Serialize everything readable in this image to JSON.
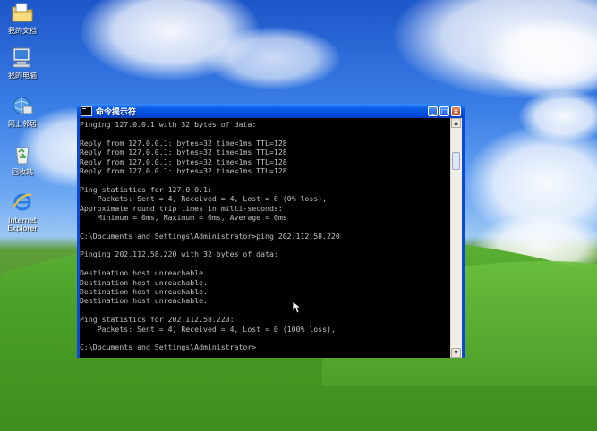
{
  "desktop": {
    "icons": [
      {
        "label": "我的文档",
        "icon": "folder-icon"
      },
      {
        "label": "我的电脑",
        "icon": "computer-icon"
      },
      {
        "label": "网上邻居",
        "icon": "network-icon"
      },
      {
        "label": "回收站",
        "icon": "recycle-bin-icon"
      },
      {
        "label": "Internet Explorer",
        "icon": "ie-icon"
      }
    ]
  },
  "window": {
    "title": "命令提示符",
    "buttons": {
      "minimize": "_",
      "maximize": "□",
      "close": "×"
    }
  },
  "console": {
    "lines": [
      "Pinging 127.0.0.1 with 32 bytes of data:",
      "",
      "Reply from 127.0.0.1: bytes=32 time<1ms TTL=128",
      "Reply from 127.0.0.1: bytes=32 time<1ms TTL=128",
      "Reply from 127.0.0.1: bytes=32 time<1ms TTL=128",
      "Reply from 127.0.0.1: bytes=32 time<1ms TTL=128",
      "",
      "Ping statistics for 127.0.0.1:",
      "    Packets: Sent = 4, Received = 4, Lost = 0 (0% loss),",
      "Approximate round trip times in milli-seconds:",
      "    Minimum = 0ms, Maximum = 0ms, Average = 0ms",
      "",
      "C:\\Documents and Settings\\Administrator>ping 202.112.58.220",
      "",
      "Pinging 202.112.58.220 with 32 bytes of data:",
      "",
      "Destination host unreachable.",
      "Destination host unreachable.",
      "Destination host unreachable.",
      "Destination host unreachable.",
      "",
      "Ping statistics for 202.112.58.220:",
      "    Packets: Sent = 4, Received = 4, Lost = 0 (100% loss),",
      "",
      "C:\\Documents and Settings\\Administrator>"
    ]
  },
  "colors": {
    "console_bg": "#000000",
    "console_fg": "#c0c0c0",
    "titlebar": "#0148d6"
  }
}
